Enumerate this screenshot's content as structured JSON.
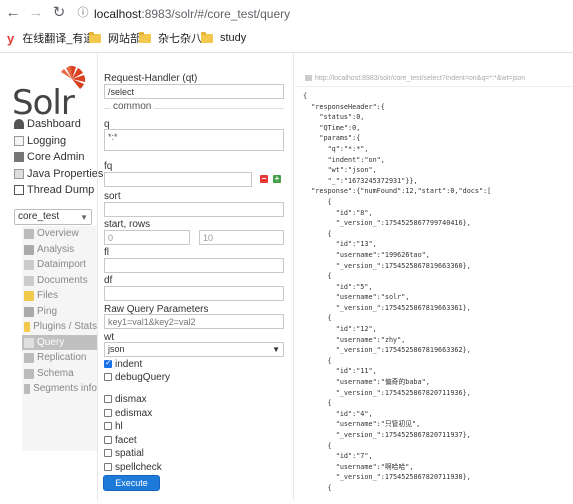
{
  "browser": {
    "url_host": "localhost",
    "url_rest": ":8983/solr/#/core_test/query",
    "bookmarks": [
      {
        "label": "在线翻译_有道"
      },
      {
        "label": "网站部"
      },
      {
        "label": "杂七杂八"
      },
      {
        "label": "study"
      }
    ]
  },
  "solr": {
    "logo": "Solr",
    "nav": [
      {
        "label": "Dashboard"
      },
      {
        "label": "Logging"
      },
      {
        "label": "Core Admin"
      },
      {
        "label": "Java Properties"
      },
      {
        "label": "Thread Dump"
      }
    ],
    "core_selected": "core_test",
    "core_nav": [
      {
        "label": "Overview"
      },
      {
        "label": "Analysis"
      },
      {
        "label": "Dataimport"
      },
      {
        "label": "Documents"
      },
      {
        "label": "Files"
      },
      {
        "label": "Ping"
      },
      {
        "label": "Plugins / Stats"
      },
      {
        "label": "Query"
      },
      {
        "label": "Replication"
      },
      {
        "label": "Schema"
      },
      {
        "label": "Segments info"
      }
    ],
    "colors": {
      "accent": "#1e7ad8",
      "logo_red": "#d9411e"
    }
  },
  "form": {
    "handler_label": "Request-Handler (qt)",
    "handler_value": "/select",
    "common_legend": "common",
    "q_label": "q",
    "q_value": "*:*",
    "fq_label": "fq",
    "sort_label": "sort",
    "start_rows_label": "start, rows",
    "start_value": "0",
    "rows_value": "10",
    "fl_label": "fl",
    "df_label": "df",
    "raw_label": "Raw Query Parameters",
    "raw_placeholder": "key1=val1&key2=val2",
    "wt_label": "wt",
    "wt_value": "json",
    "indent_label": "indent",
    "debug_label": "debugQuery",
    "dismax_label": "dismax",
    "edismax_label": "edismax",
    "hl_label": "hl",
    "facet_label": "facet",
    "spatial_label": "spatial",
    "spellcheck_label": "spellcheck",
    "execute_label": "Execute Query"
  },
  "response": {
    "url": "http://localhost:8983/solr/core_test/select?indent=on&q=*:*&wt=json",
    "lines": [
      "{",
      "  \"responseHeader\":{",
      "    \"status\":0,",
      "    \"QTime\":0,",
      "    \"params\":{",
      "      \"q\":\"*:*\",",
      "      \"indent\":\"on\",",
      "      \"wt\":\"json\",",
      "      \"_\":\"1673245372931\"}},",
      "  \"response\":{\"numFound\":12,\"start\":0,\"docs\":[",
      "      {",
      "        \"id\":\"8\",",
      "        \"_version_\":1754525867799740416},",
      "      {",
      "        \"id\":\"13\",",
      "        \"username\":\"199626tao\",",
      "        \"_version_\":1754525867819663360},",
      "      {",
      "        \"id\":\"5\",",
      "        \"username\":\"solr\",",
      "        \"_version_\":1754525867819663361},",
      "      {",
      "        \"id\":\"12\",",
      "        \"username\":\"zhy\",",
      "        \"_version_\":1754525867819663362},",
      "      {",
      "        \"id\":\"11\",",
      "        \"username\":\"偏奇的baba\",",
      "        \"_version_\":1754525867820711936},",
      "      {",
      "        \"id\":\"4\",",
      "        \"username\":\"只管初见\",",
      "        \"_version_\":1754525867820711937},",
      "      {",
      "        \"id\":\"7\",",
      "        \"username\":\"啊哈哈\",",
      "        \"_version_\":1754525867820711938},",
      "      {"
    ]
  }
}
